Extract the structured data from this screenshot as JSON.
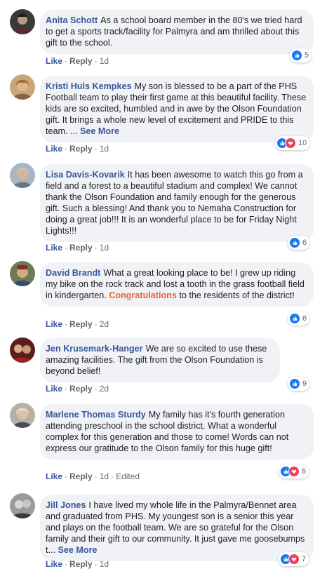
{
  "comments": [
    {
      "author": "Anita Schott",
      "text": "As a school board member in the 80's we tried hard to get a sports track/facility for Palmyra and am thrilled about this gift to the school.",
      "like_label": "Like",
      "reply_label": "Reply",
      "time": "1d",
      "reactions": [
        "like"
      ],
      "reaction_count": "5"
    },
    {
      "author": "Kristi Huls Kempkes",
      "text": "My son is blessed to be a part of the PHS Football team to play their first game at this beautiful facility. These kids are so excited, humbled and in awe by the Olson Foundation gift. It brings a whole new level of excitement and PRIDE to this team. ...",
      "see_more": "See More",
      "like_label": "Like",
      "reply_label": "Reply",
      "time": "1d",
      "reactions": [
        "like",
        "love"
      ],
      "reaction_count": "10"
    },
    {
      "author": "Lisa Davis-Kovarik",
      "text": "It has been awesome to watch this go from a field and a forest to a beautiful stadium and complex! We cannot thank the Olson Foundation and family enough for the generous gift. Such a blessing! And thank you to Nemaha Construction for doing a great job!!! It is an wonderful place to be for Friday Night Lights!!!",
      "like_label": "Like",
      "reply_label": "Reply",
      "time": "1d",
      "reactions": [
        "like"
      ],
      "reaction_count": "6"
    },
    {
      "author": "David Brandt",
      "text_before": "What a great looking place to be! I grew up riding my bike on the rock track and lost a tooth in the grass football field in kindergarten.",
      "highlight": "Congratulations",
      "text_after": "to the residents of the district!",
      "like_label": "Like",
      "reply_label": "Reply",
      "time": "2d",
      "reactions": [
        "like"
      ],
      "reaction_count": "6"
    },
    {
      "author": "Jen Krusemark-Hanger",
      "text": "We are so excited to use these amazing facilities. The gift from the Olson Foundation is beyond belief!",
      "like_label": "Like",
      "reply_label": "Reply",
      "time": "2d",
      "reactions": [
        "like"
      ],
      "reaction_count": "9"
    },
    {
      "author": "Marlene Thomas Sturdy",
      "text": "My family has it's fourth generation attending preschool in the school district. What a wonderful complex for this generation and those to come! Words can not express our gratitude to the Olson family for this huge gift!",
      "like_label": "Like",
      "reply_label": "Reply",
      "time": "1d",
      "edited": "Edited",
      "reactions": [
        "like",
        "love"
      ],
      "reaction_count": "6"
    },
    {
      "author": "Jill Jones",
      "text": "I have lived my whole life in the Palmyra/Bennet area and graduated from PHS. My youngest son is a senior this year and plays on the football team. We are so grateful for the Olson family and their gift to our community. It just gave me goosebumps t...",
      "see_more": "See More",
      "like_label": "Like",
      "reply_label": "Reply",
      "time": "1d",
      "reactions": [
        "like",
        "love"
      ],
      "reaction_count": "7"
    }
  ],
  "colors": {
    "author": "#385898",
    "bubble": "#f0f2f5",
    "like_reaction": "#1877f2",
    "love_reaction": "#f33e58",
    "highlight": "#e4633d"
  },
  "icons": {
    "like": "thumbs-up-icon",
    "love": "heart-icon"
  }
}
